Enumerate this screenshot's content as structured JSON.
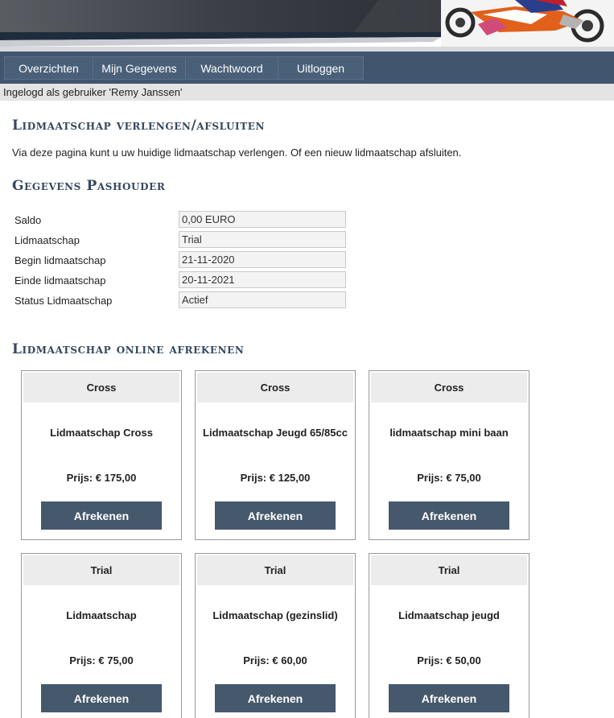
{
  "nav": {
    "items": [
      {
        "label": "Overzichten"
      },
      {
        "label": "Mijn Gegevens"
      },
      {
        "label": "Wachtwoord"
      },
      {
        "label": "Uitloggen"
      }
    ]
  },
  "login_status": "Ingelogd als gebruiker 'Remy Janssen'",
  "page": {
    "title": "Lidmaatschap verlengen/afsluiten",
    "intro": "Via deze pagina kunt u uw huidige lidmaatschap verlengen. Of een nieuw lidmaatschap afsluiten.",
    "details_title": "Gegevens Pashouder",
    "online_title": "Lidmaatschap online afrekenen"
  },
  "details": [
    {
      "label": "Saldo",
      "value": "0,00 EURO"
    },
    {
      "label": "Lidmaatschap",
      "value": "Trial"
    },
    {
      "label": "Begin lidmaatschap",
      "value": "21-11-2020"
    },
    {
      "label": "Einde lidmaatschap",
      "value": "20-11-2021"
    },
    {
      "label": "Status Lidmaatschap",
      "value": "Actief"
    }
  ],
  "products": [
    {
      "category": "Cross",
      "name": "Lidmaatschap Cross",
      "price": "Prijs: € 175,00",
      "button": "Afrekenen"
    },
    {
      "category": "Cross",
      "name": "Lidmaatschap Jeugd 65/85cc",
      "price": "Prijs: € 125,00",
      "button": "Afrekenen"
    },
    {
      "category": "Cross",
      "name": "lidmaatschap mini baan",
      "price": "Prijs: € 75,00",
      "button": "Afrekenen"
    },
    {
      "category": "Trial",
      "name": "Lidmaatschap",
      "price": "Prijs: € 75,00",
      "button": "Afrekenen"
    },
    {
      "category": "Trial",
      "name": "Lidmaatschap (gezinslid)",
      "price": "Prijs: € 60,00",
      "button": "Afrekenen"
    },
    {
      "category": "Trial",
      "name": "Lidmaatschap jeugd",
      "price": "Prijs: € 50,00",
      "button": "Afrekenen"
    }
  ],
  "colors": {
    "navbar": "#41566e",
    "button": "#46586c",
    "heading": "#34495e",
    "login_bar": "#e4e4e4",
    "card_header": "#ececec"
  }
}
